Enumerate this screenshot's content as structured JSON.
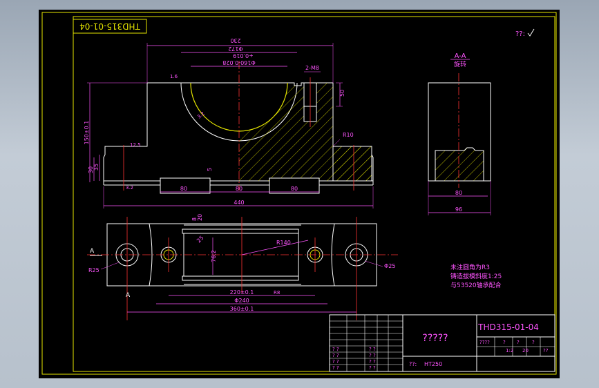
{
  "title_box": {
    "code": "THD315-01-04"
  },
  "top_right_symbol": "??:",
  "section": {
    "label": "A-A",
    "sub": "旋转"
  },
  "section_markers": {
    "upper": "A",
    "lower": "A"
  },
  "front_view": {
    "dims": {
      "overall_top": "230",
      "bore_outer": "Φ172",
      "bore_tol_a": "+0.019",
      "bore_tol_b": "Φ160-0.028",
      "groove_depth": "2-M8",
      "bolt_height": "50",
      "left_height": "150±0.1",
      "base_h1": "30",
      "base_h2": "35",
      "seg1": "80",
      "seg2": "80",
      "seg3": "80",
      "gap": "5",
      "width_total": "440",
      "radius": "R10",
      "rough_a": "1.6",
      "rough_b": "3.2",
      "rough_c": "12.5",
      "rough_d": "3.2"
    }
  },
  "section_view": {
    "dims": {
      "inner": "80",
      "outer": "96"
    }
  },
  "top_view": {
    "dims": {
      "h1": "8",
      "h2": "20",
      "inner": "25",
      "dist1": "76.2",
      "radius": "R140",
      "hole_l": "R25",
      "hole_r": "Φ25",
      "width_a": "220±0.1",
      "width_b": "Φ240",
      "width_total": "360±0.1",
      "r_dim": "R8"
    }
  },
  "notes": [
    "未注圆角为R3",
    "铸造拔模斜度1:25",
    "与53520轴承配合"
  ],
  "title_block": {
    "drawing_no": "THD315-01-04",
    "name": "?????",
    "material": "HT250",
    "material_label": "??:",
    "scale": "1:2",
    "sheet_a": "20",
    "sheet_b": "??",
    "mass_label": "????",
    "q1": "?",
    "q2": "?",
    "q3": "?",
    "left_marks": [
      "? ?",
      "? ?",
      "? ?",
      "? ?"
    ],
    "mid_marks": [
      "? ?",
      "? ?",
      "? ?",
      "? ?"
    ]
  }
}
